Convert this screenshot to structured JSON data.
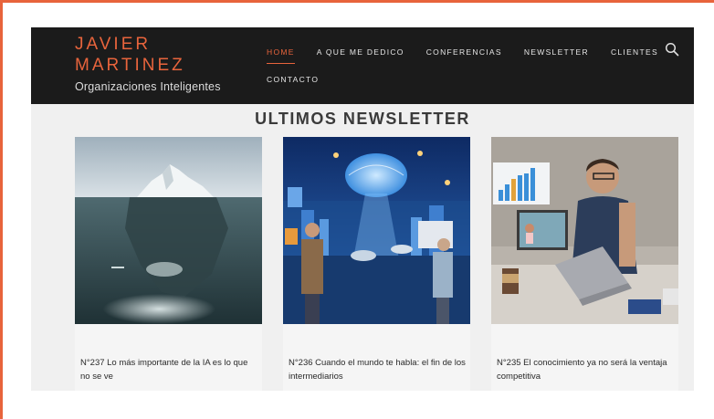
{
  "brand": {
    "name_line1": "JAVIER",
    "name_line2": "MARTINEZ",
    "tagline": "Organizaciones Inteligentes",
    "accent_color": "#e8643c"
  },
  "nav": {
    "items": [
      {
        "label": "HOME",
        "active": true
      },
      {
        "label": "A QUE ME DEDICO",
        "active": false
      },
      {
        "label": "CONFERENCIAS",
        "active": false
      },
      {
        "label": "NEWSLETTER",
        "active": false
      },
      {
        "label": "CLIENTES",
        "active": false
      },
      {
        "label": "CONTACTO",
        "active": false
      }
    ],
    "search_icon": "search-icon"
  },
  "section": {
    "title": "ULTIMOS NEWSLETTER"
  },
  "posts": [
    {
      "title": "N°237 Lo más importante de la IA es lo que no se ve",
      "image": "iceberg"
    },
    {
      "title": "N°236 Cuando el mundo te habla: el fin de los intermediarios",
      "image": "ai-city"
    },
    {
      "title": "N°235 El conocimiento ya no será la ventaja competitiva",
      "image": "laptop-learner"
    }
  ]
}
